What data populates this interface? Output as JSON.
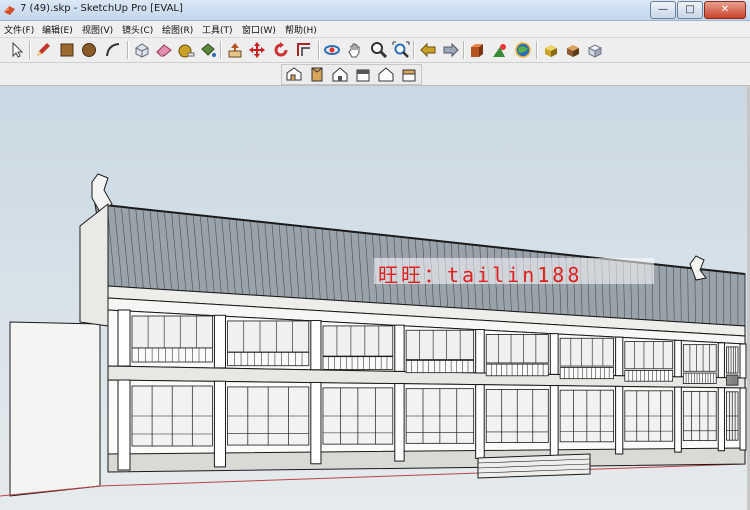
{
  "window": {
    "title": "7 (49).skp - SketchUp Pro [EVAL]",
    "buttons": [
      {
        "name": "minimize",
        "glyph": "—"
      },
      {
        "name": "maximize",
        "glyph": "□"
      },
      {
        "name": "close",
        "glyph": "✕"
      }
    ]
  },
  "menu": [
    {
      "label": "文件(F)"
    },
    {
      "label": "编辑(E)"
    },
    {
      "label": "视图(V)"
    },
    {
      "label": "镜头(C)"
    },
    {
      "label": "绘图(R)"
    },
    {
      "label": "工具(T)"
    },
    {
      "label": "窗口(W)"
    },
    {
      "label": "帮助(H)"
    }
  ],
  "toolbar": {
    "tools": [
      {
        "icon": "select-icon",
        "color": "#444444"
      },
      {
        "icon": "pencil-icon",
        "color": "#c0392b"
      },
      {
        "icon": "rectangle-icon",
        "color": "#9a6a2f"
      },
      {
        "icon": "circle-icon",
        "color": "#8b5a2b"
      },
      {
        "icon": "arc-icon",
        "color": "#333333"
      },
      {
        "icon": "make-component-icon",
        "color": "#9aa8b8"
      },
      {
        "icon": "eraser-icon",
        "color": "#e08fb0"
      },
      {
        "icon": "tape-measure-icon",
        "color": "#c9a227"
      },
      {
        "icon": "paint-bucket-icon",
        "color": "#5a8a3a"
      },
      {
        "icon": "push-pull-icon",
        "color": "#b5541f"
      },
      {
        "icon": "move-icon",
        "color": "#cc2222"
      },
      {
        "icon": "rotate-icon",
        "color": "#cc3333"
      },
      {
        "icon": "offset-icon",
        "color": "#aa2222"
      },
      {
        "icon": "orbit-icon",
        "color": "#2a6fb5"
      },
      {
        "icon": "pan-icon",
        "color": "#555555"
      },
      {
        "icon": "zoom-icon",
        "color": "#333333"
      },
      {
        "icon": "zoom-extents-icon",
        "color": "#2a6fb5"
      },
      {
        "icon": "previous-view-icon",
        "color": "#c9a227"
      },
      {
        "icon": "next-view-icon",
        "color": "#9aa8b8"
      },
      {
        "icon": "get-models-icon",
        "color": "#b5541f"
      },
      {
        "icon": "share-model-icon",
        "color": "#3a8a3a"
      },
      {
        "icon": "google-earth-icon",
        "color": "#2a6fb5"
      },
      {
        "icon": "components-icon",
        "color": "#c9a227"
      },
      {
        "icon": "warehouse-icon",
        "color": "#8b5a2b"
      },
      {
        "icon": "extension-icon",
        "color": "#9aa8b8"
      }
    ]
  },
  "views_toolbar": {
    "tools": [
      {
        "icon": "iso-view-icon"
      },
      {
        "icon": "top-view-icon"
      },
      {
        "icon": "front-view-icon"
      },
      {
        "icon": "right-view-icon"
      },
      {
        "icon": "back-view-icon"
      },
      {
        "icon": "left-view-icon"
      }
    ]
  },
  "watermark": {
    "text": "旺旺：tailin188",
    "color": "#e02020"
  },
  "scene": {
    "model": "chinese-two-storey-pavilion",
    "roof_color": "#9aa3aa",
    "line_color": "#1a1a1a",
    "face_color": "#f4f4f2"
  }
}
